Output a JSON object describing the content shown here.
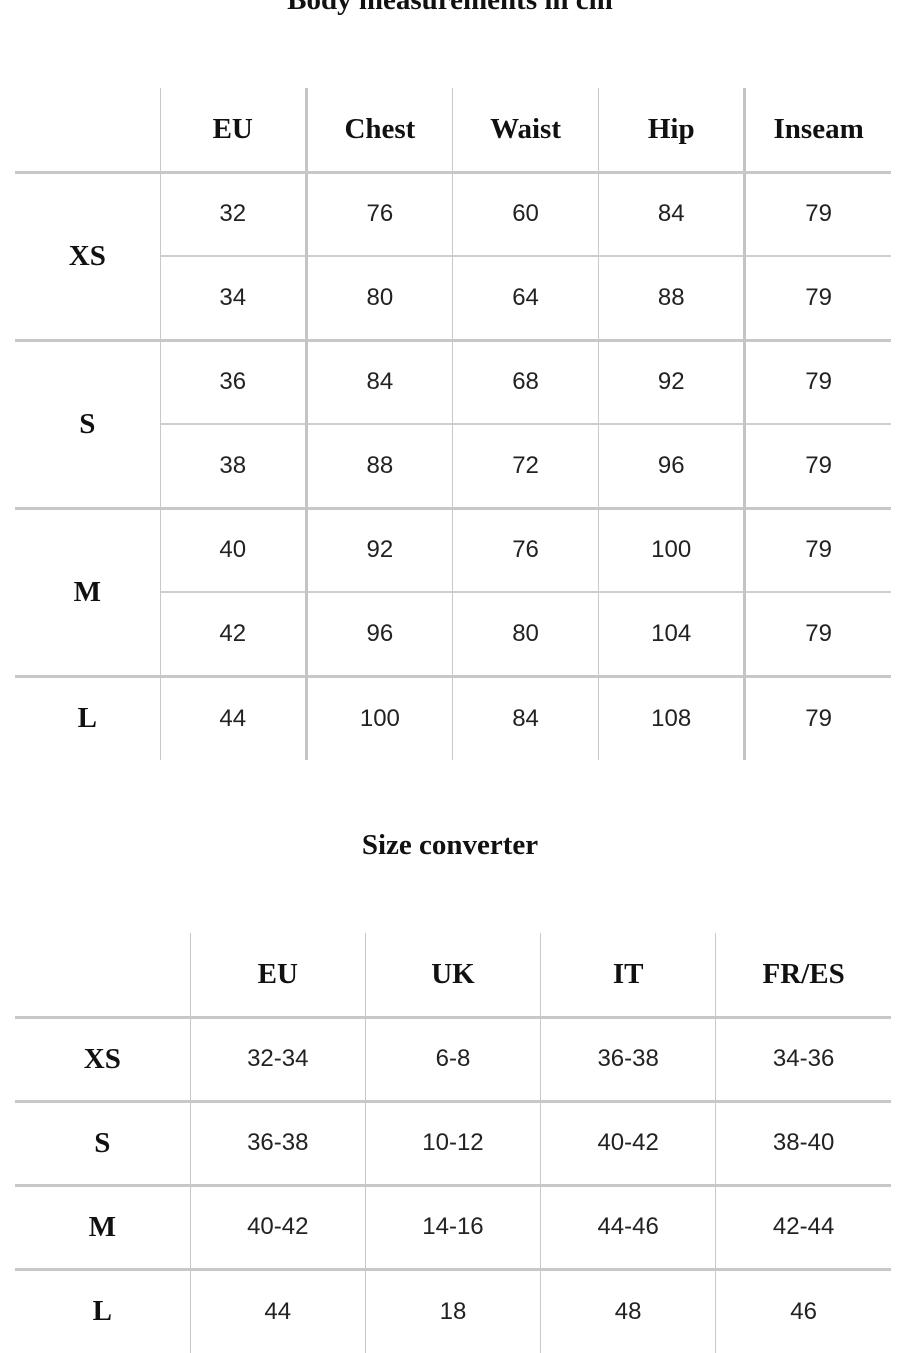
{
  "body_measurements": {
    "title": "Body measurements in cm",
    "headers": [
      "",
      "EU",
      "Chest",
      "Waist",
      "Hip",
      "Inseam"
    ],
    "groups": [
      {
        "size": "XS",
        "rows": [
          {
            "eu": "32",
            "chest": "76",
            "waist": "60",
            "hip": "84",
            "inseam": "79"
          },
          {
            "eu": "34",
            "chest": "80",
            "waist": "64",
            "hip": "88",
            "inseam": "79"
          }
        ]
      },
      {
        "size": "S",
        "rows": [
          {
            "eu": "36",
            "chest": "84",
            "waist": "68",
            "hip": "92",
            "inseam": "79"
          },
          {
            "eu": "38",
            "chest": "88",
            "waist": "72",
            "hip": "96",
            "inseam": "79"
          }
        ]
      },
      {
        "size": "M",
        "rows": [
          {
            "eu": "40",
            "chest": "92",
            "waist": "76",
            "hip": "100",
            "inseam": "79"
          },
          {
            "eu": "42",
            "chest": "96",
            "waist": "80",
            "hip": "104",
            "inseam": "79"
          }
        ]
      },
      {
        "size": "L",
        "rows": [
          {
            "eu": "44",
            "chest": "100",
            "waist": "84",
            "hip": "108",
            "inseam": "79"
          }
        ]
      }
    ]
  },
  "size_converter": {
    "title": "Size converter",
    "headers": [
      "",
      "EU",
      "UK",
      "IT",
      "FR/ES"
    ],
    "rows": [
      {
        "size": "XS",
        "eu": "32-34",
        "uk": "6-8",
        "it": "36-38",
        "fres": "34-36"
      },
      {
        "size": "S",
        "eu": "36-38",
        "uk": "10-12",
        "it": "40-42",
        "fres": "38-40"
      },
      {
        "size": "M",
        "eu": "40-42",
        "uk": "14-16",
        "it": "44-46",
        "fres": "42-44"
      },
      {
        "size": "L",
        "eu": "44",
        "uk": "18",
        "it": "48",
        "fres": "46"
      }
    ]
  },
  "colors": {
    "border": "#c8c8c8",
    "text": "#111111",
    "background": "#ffffff"
  }
}
